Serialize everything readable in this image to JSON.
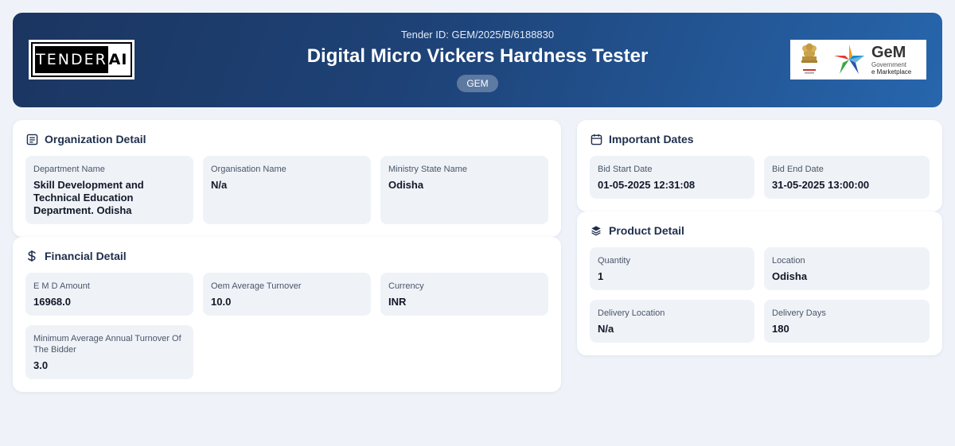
{
  "header": {
    "tender_id": "Tender ID: GEM/2025/B/6188830",
    "title": "Digital Micro Vickers Hardness Tester",
    "badge": "GEM",
    "logo_left": {
      "part1": "TENDER",
      "part2": "AI"
    },
    "logo_right": {
      "name": "GeM",
      "line1": "Government",
      "line2": "e Marketplace"
    }
  },
  "organization": {
    "title": "Organization Detail",
    "icon": "document-list-icon",
    "fields": [
      {
        "label": "Department Name",
        "value": "Skill Development and Technical Education Department. Odisha"
      },
      {
        "label": "Organisation Name",
        "value": "N/a"
      },
      {
        "label": "Ministry State Name",
        "value": "Odisha"
      }
    ]
  },
  "financial": {
    "title": "Financial Detail",
    "icon": "dollar-icon",
    "fields": [
      {
        "label": "E M D Amount",
        "value": "16968.0"
      },
      {
        "label": "Oem Average Turnover",
        "value": "10.0"
      },
      {
        "label": "Currency",
        "value": "INR"
      },
      {
        "label": "Minimum Average Annual Turnover Of The Bidder",
        "value": "3.0"
      }
    ]
  },
  "dates": {
    "title": "Important Dates",
    "icon": "calendar-icon",
    "fields": [
      {
        "label": "Bid Start Date",
        "value": "01-05-2025 12:31:08"
      },
      {
        "label": "Bid End Date",
        "value": "31-05-2025 13:00:00"
      }
    ]
  },
  "product": {
    "title": "Product Detail",
    "icon": "layers-icon",
    "fields": [
      {
        "label": "Quantity",
        "value": "1"
      },
      {
        "label": "Location",
        "value": "Odisha"
      },
      {
        "label": "Delivery Location",
        "value": "N/a"
      },
      {
        "label": "Delivery Days",
        "value": "180"
      }
    ]
  },
  "colors": {
    "header_start": "#1b3560",
    "header_end": "#2766ad",
    "page_bg": "#eff3f9",
    "field_bg": "#eff3f8",
    "title_text": "#1e2f4d"
  }
}
